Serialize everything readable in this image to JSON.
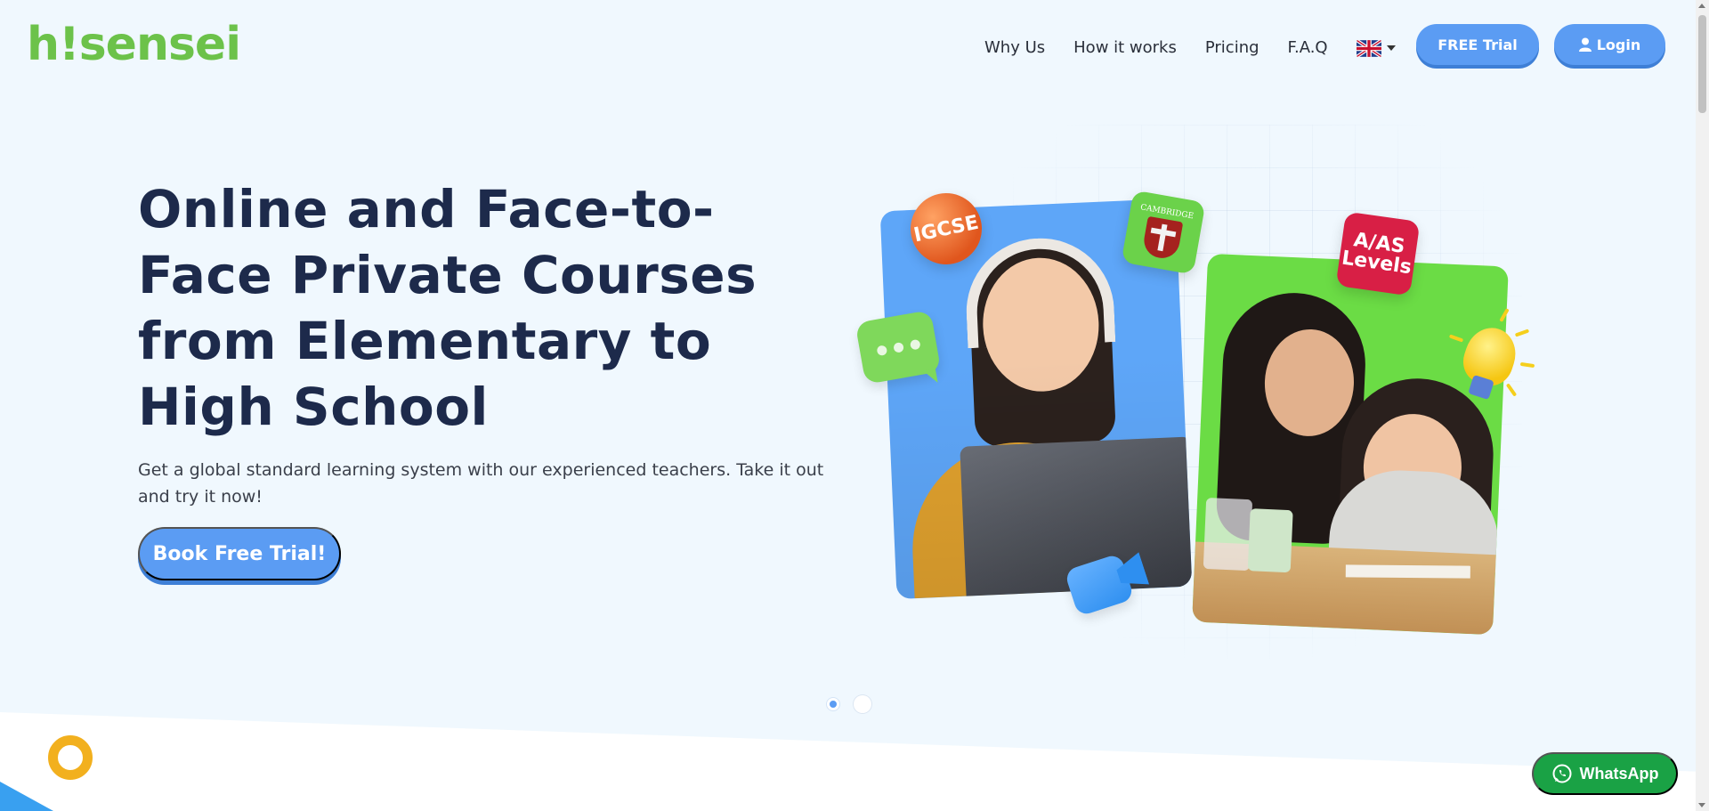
{
  "header": {
    "logo": "h!sensei",
    "nav": [
      "Why Us",
      "How it works",
      "Pricing",
      "F.A.Q"
    ],
    "language_icon": "uk-flag-icon",
    "trial_button": "FREE Trial",
    "login_button": "Login"
  },
  "hero": {
    "title": "Online and Face-to-Face Private Courses from Elementary to High School",
    "subtitle": "Get a global standard learning system with our experienced teachers. Take it out and try it now!",
    "cta": "Book Free Trial!"
  },
  "illustration": {
    "badge_igcse": "IGCSE",
    "badge_cambridge": "CAMBRIDGE",
    "badge_alevels_line1": "A/AS",
    "badge_alevels_line2": "Levels"
  },
  "carousel": {
    "slides": 2,
    "active": 1
  },
  "whatsapp": {
    "label": "WhatsApp"
  },
  "colors": {
    "brand_green": "#6cc24a",
    "primary_blue": "#5b9cf3",
    "whatsapp_green": "#1aa245",
    "ring_yellow": "#f2b01e"
  }
}
